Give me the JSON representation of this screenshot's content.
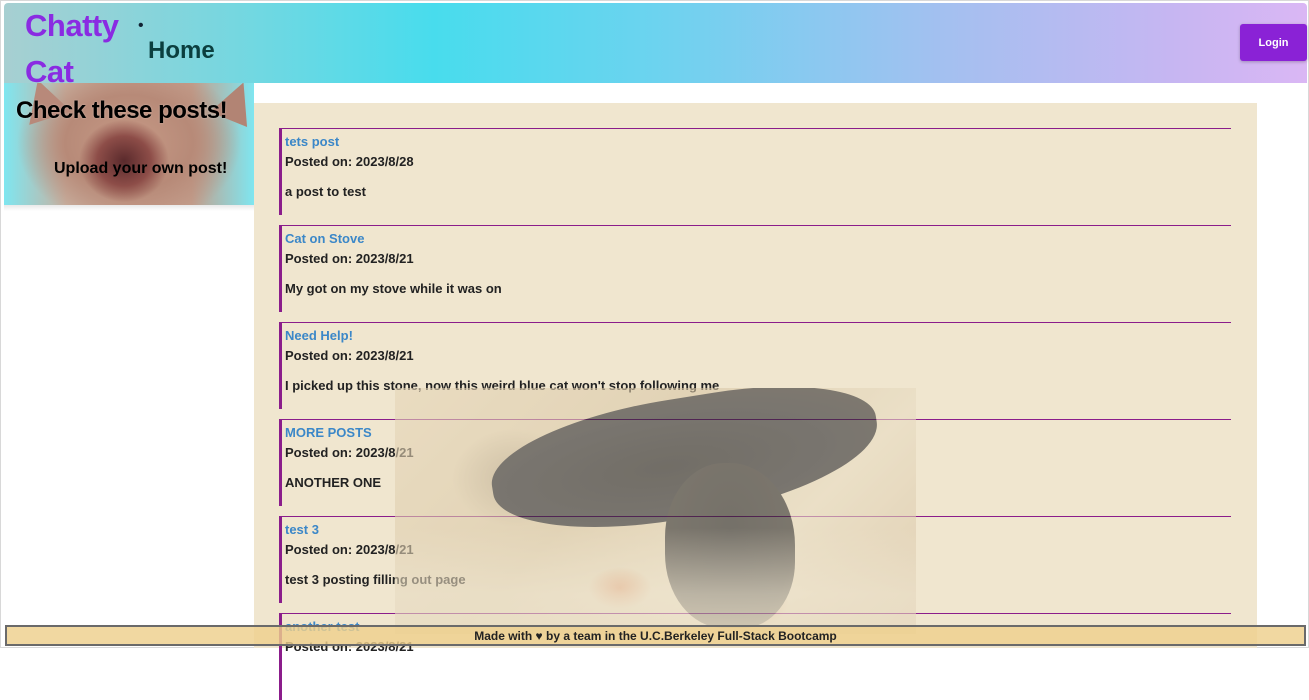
{
  "header": {
    "brand_line1": "Chatty",
    "brand_line2": "Cat",
    "nav_dot": "•",
    "nav_home": "Home",
    "login_label": "Login"
  },
  "sidebar": {
    "title": "Check these posts!",
    "upload_link": "Upload your own post!"
  },
  "posts": [
    {
      "title": "tets post",
      "date": "Posted on: 2023/8/28",
      "body": "a post to test"
    },
    {
      "title": "Cat on Stove",
      "date": "Posted on: 2023/8/21",
      "body": "My got on my stove while it was on"
    },
    {
      "title": "Need Help!",
      "date": "Posted on: 2023/8/21",
      "body": "I picked up this stone, now this weird blue cat won't stop following me"
    },
    {
      "title": "MORE POSTS",
      "date": "Posted on: 2023/8/21",
      "body": "ANOTHER ONE"
    },
    {
      "title": "test 3",
      "date": "Posted on: 2023/8/21",
      "body": "test 3 posting filling out page"
    },
    {
      "title": "another test",
      "date": "Posted on: 2023/8/21",
      "body": ""
    }
  ],
  "footer": {
    "text": "Made with ♥ by a team in the U.C.Berkeley Full-Stack Bootcamp"
  },
  "colors": {
    "brand": "#8a2be2",
    "login_button": "#8a22d6",
    "post_border": "#8b1d8b",
    "post_title": "#3b87c8",
    "main_background": "#f0e6cf"
  }
}
